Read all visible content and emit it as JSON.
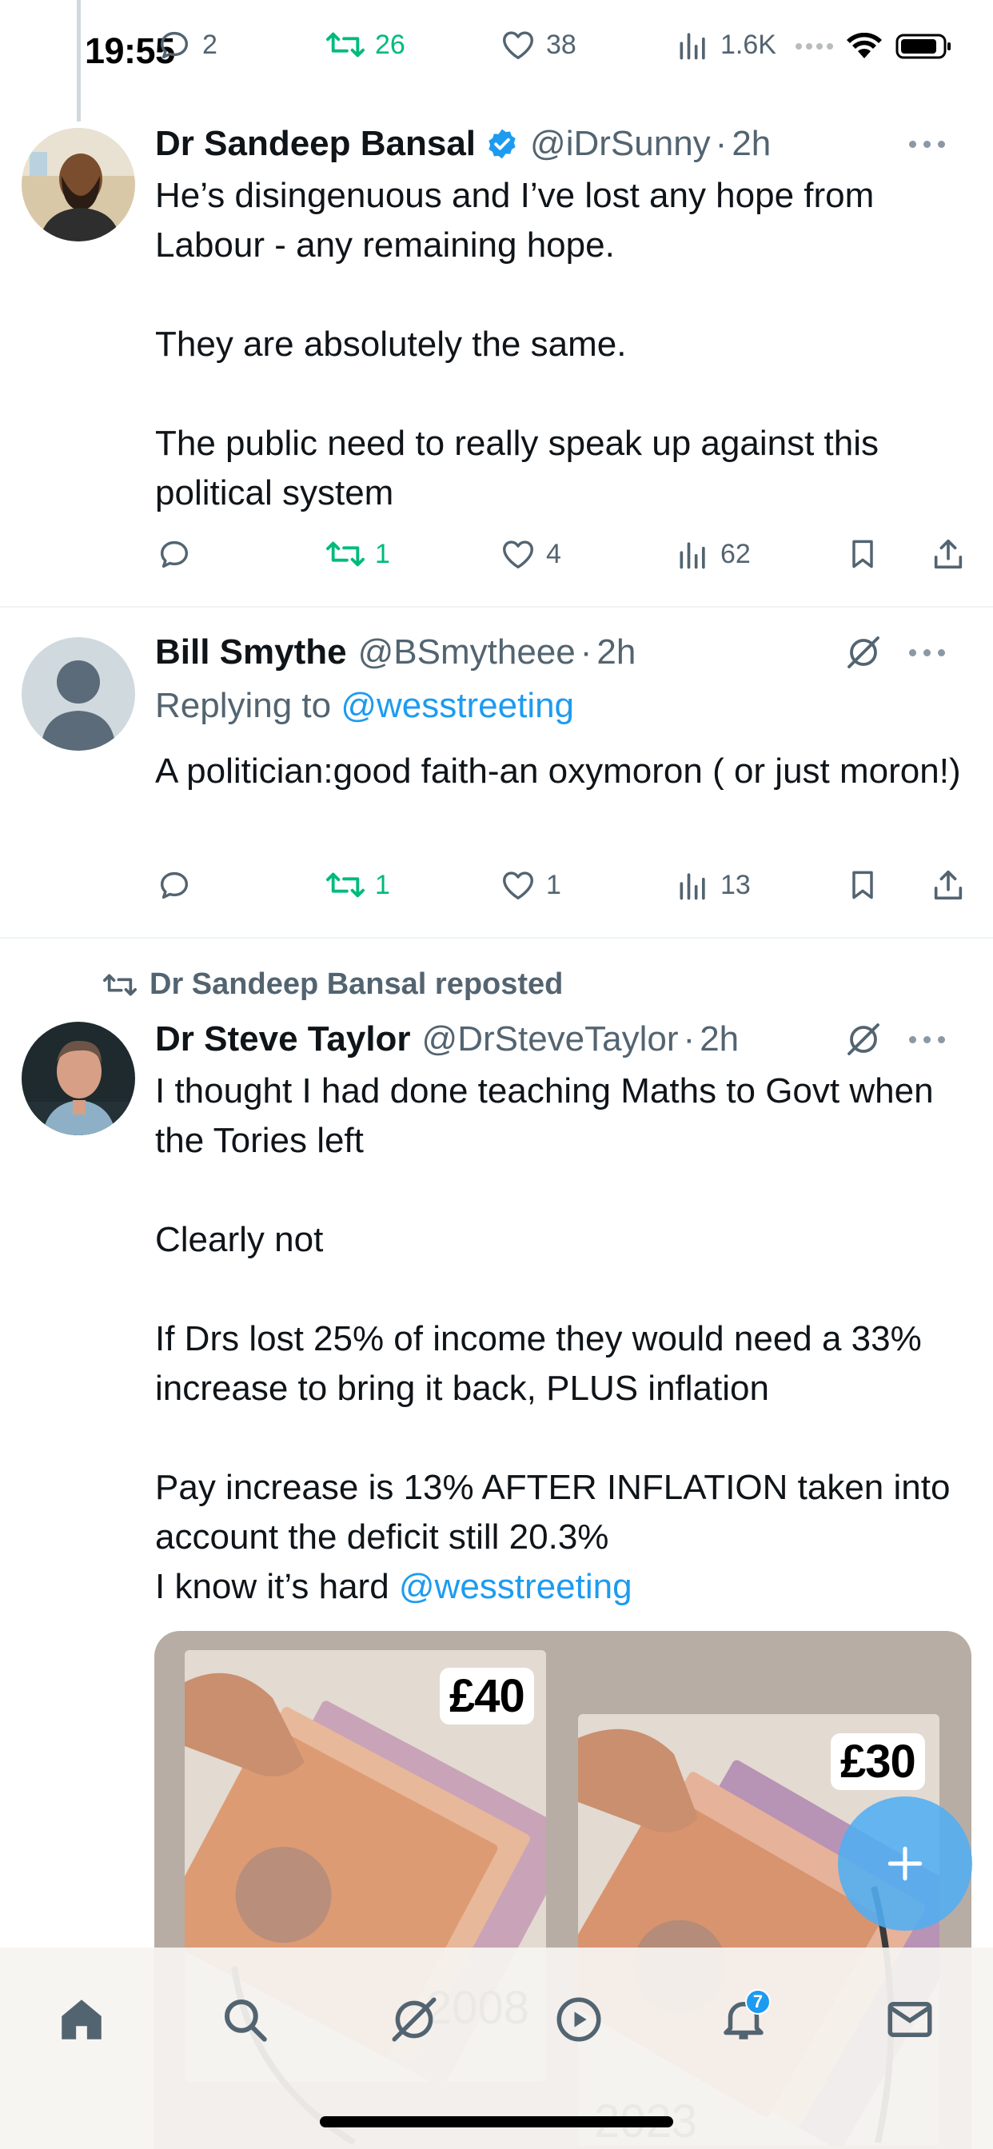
{
  "status_bar": {
    "time": "19:55"
  },
  "top_actions": {
    "replies": "2",
    "reposts": "26",
    "likes": "38",
    "views": "1.6K"
  },
  "tweets": [
    {
      "name": "Dr Sandeep Bansal",
      "handle": "@iDrSunny",
      "dot": "·",
      "time": "2h",
      "verified": true,
      "paragraphs": [
        "He’s disingenuous and I’ve lost any hope from Labour - any remaining hope.",
        "",
        "They are absolutely the same.",
        "",
        "The public need to really speak up against this political system"
      ],
      "actions": {
        "replies": "",
        "reposts": "1",
        "likes": "4",
        "views": "62"
      }
    },
    {
      "name": "Bill Smythe",
      "handle": "@BSmytheee",
      "dot": "·",
      "time": "2h",
      "replying_prefix": "Replying to ",
      "replying_handle": "@wesstreeting",
      "paragraphs": [
        "A politician:good faith-an oxymoron ( or just moron!)"
      ],
      "actions": {
        "replies": "",
        "reposts": "1",
        "likes": "1",
        "views": "13"
      }
    },
    {
      "reposted_by": "Dr Sandeep Bansal reposted",
      "name": "Dr Steve Taylor",
      "handle": "@DrSteveTaylor",
      "dot": "·",
      "time": "2h",
      "paragraphs": [
        "I thought I had done teaching Maths to Govt when the Tories left",
        "",
        "Clearly not",
        "",
        "If Drs lost 25% of income they would need a 33% increase to bring it back, PLUS inflation",
        "",
        "Pay increase is 13% AFTER INFLATION taken into account the deficit still 20.3%"
      ],
      "last_line_prefix": "I know it’s hard ",
      "last_line_link": "@wesstreeting",
      "media": {
        "price_left": "£40",
        "price_right": "£30",
        "year_left": "2008",
        "year_right": "2023"
      }
    }
  ],
  "bottom_nav": {
    "notifications_badge": "7"
  },
  "colors": {
    "accent": "#1d9bf0",
    "repost_green": "#00ba7c",
    "muted": "#536471",
    "text": "#0f1419"
  },
  "icons": [
    "reply-icon",
    "repost-icon",
    "like-icon",
    "views-icon",
    "bookmark-icon",
    "share-icon",
    "verified-icon",
    "grok-icon",
    "more-icon",
    "home-icon",
    "search-icon",
    "grok-nav-icon",
    "play-icon",
    "bell-icon",
    "mail-icon",
    "plus-icon"
  ]
}
